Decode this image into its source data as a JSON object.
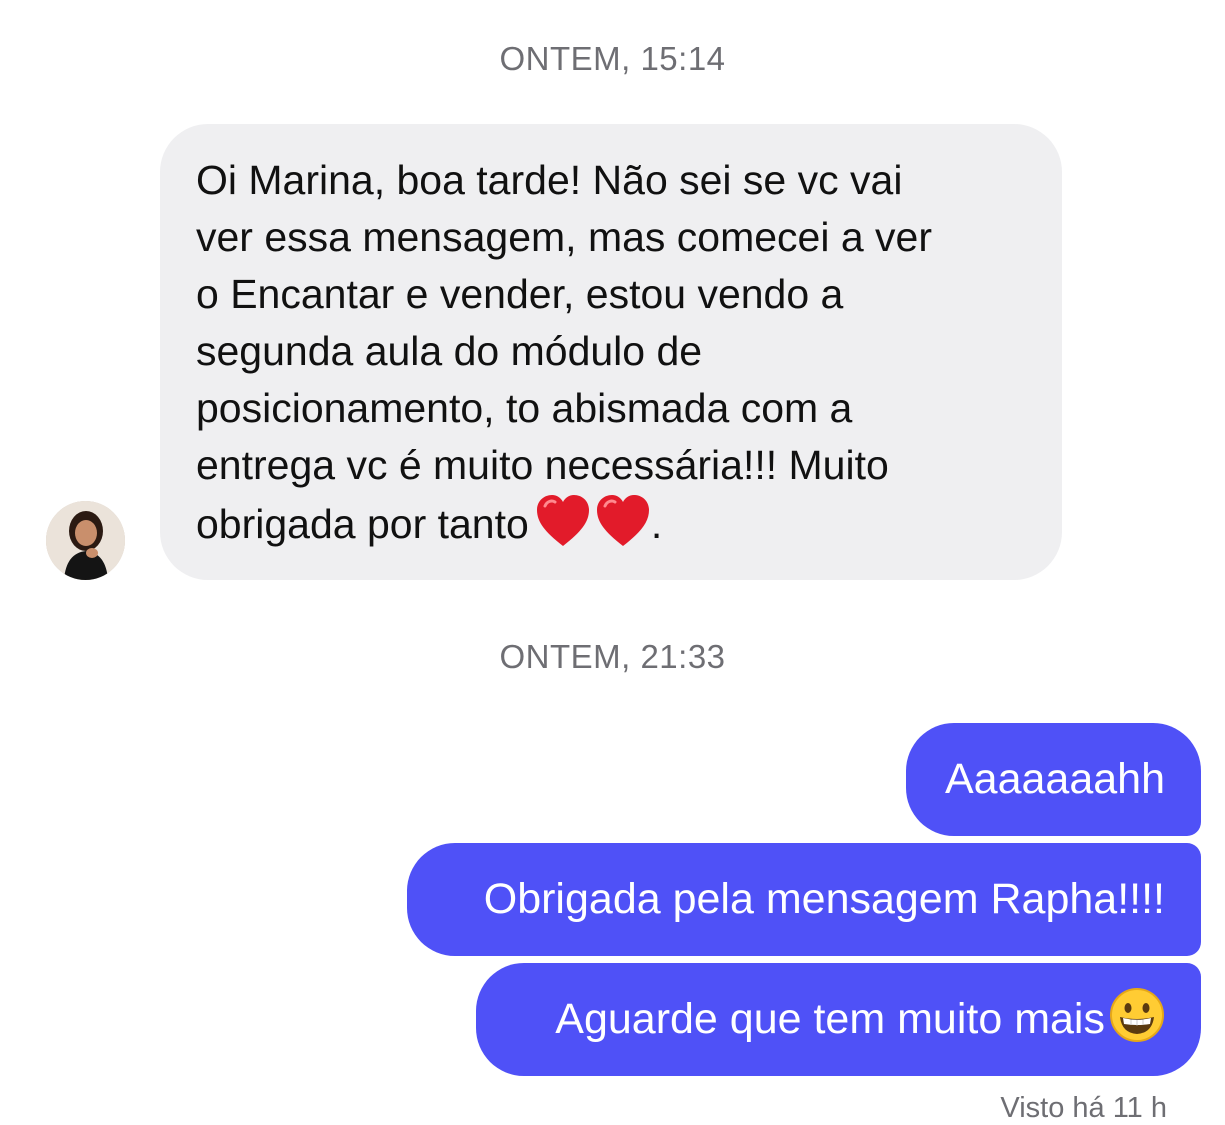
{
  "conversation": {
    "timestamp_1": "ONTEM, 15:14",
    "timestamp_2": "ONTEM, 21:33",
    "incoming": {
      "text": "Oi Marina, boa tarde! Não sei se vc vai\nver essa mensagem, mas comecei a ver\no Encantar e vender, estou vendo a\nsegunda aula do módulo de\nposicionamento, to abismada com a\nentrega vc é muito necessária!!! Muito\nobrigada por tanto",
      "emoji": [
        "red-heart",
        "red-heart"
      ],
      "trailing": "."
    },
    "outgoing": [
      {
        "text": "Aaaaaaahh"
      },
      {
        "text": "Obrigada pela mensagem Rapha!!!!"
      },
      {
        "text": "Aguarde que tem muito mais",
        "emoji": "grinning-face"
      }
    ],
    "seen_status": "Visto há 11 h"
  },
  "colors": {
    "incoming_bubble": "#efeff1",
    "outgoing_bubble": "#4f51f7",
    "timestamp_text": "#6e6e73"
  }
}
